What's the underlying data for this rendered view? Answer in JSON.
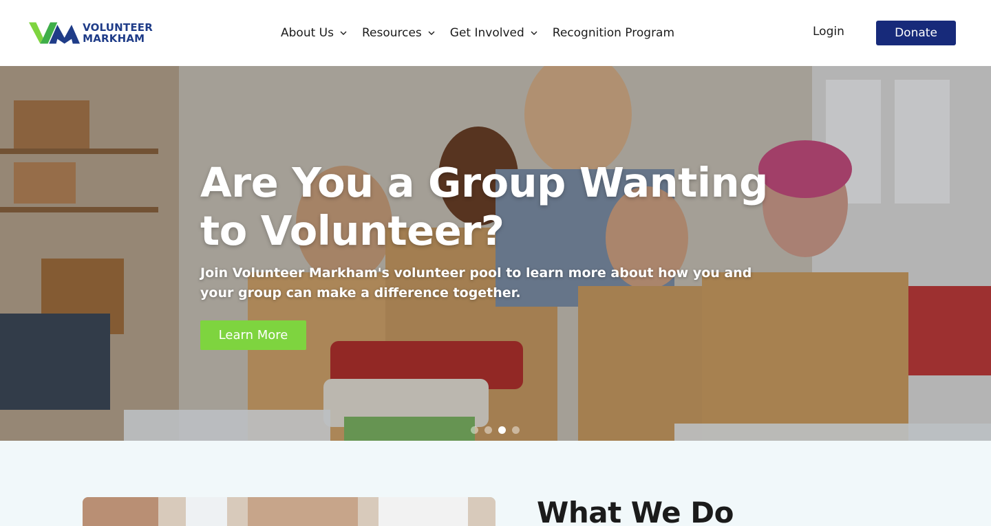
{
  "header": {
    "logo": {
      "line1": "VOLUNTEER",
      "line2": "MARKHAM",
      "icon": "vm-logo-icon"
    },
    "nav": [
      {
        "label": "About Us",
        "has_dropdown": true
      },
      {
        "label": "Resources",
        "has_dropdown": true
      },
      {
        "label": "Get Involved",
        "has_dropdown": true
      },
      {
        "label": "Recognition Program",
        "has_dropdown": false
      }
    ],
    "login_label": "Login",
    "donate_label": "Donate"
  },
  "hero": {
    "title": "Are You a Group Wanting to Volunteer?",
    "subtitle": "Join Volunteer Markham's volunteer pool to learn more about how you and your group can make a difference together.",
    "button_label": "Learn More",
    "slides": {
      "count": 4,
      "active_index": 2
    }
  },
  "section": {
    "title": "What We Do"
  },
  "colors": {
    "brand_navy": "#172a7a",
    "brand_green": "#7ed43f",
    "logo_blue": "#1f3c88",
    "section_bg": "#f1f8fa"
  }
}
